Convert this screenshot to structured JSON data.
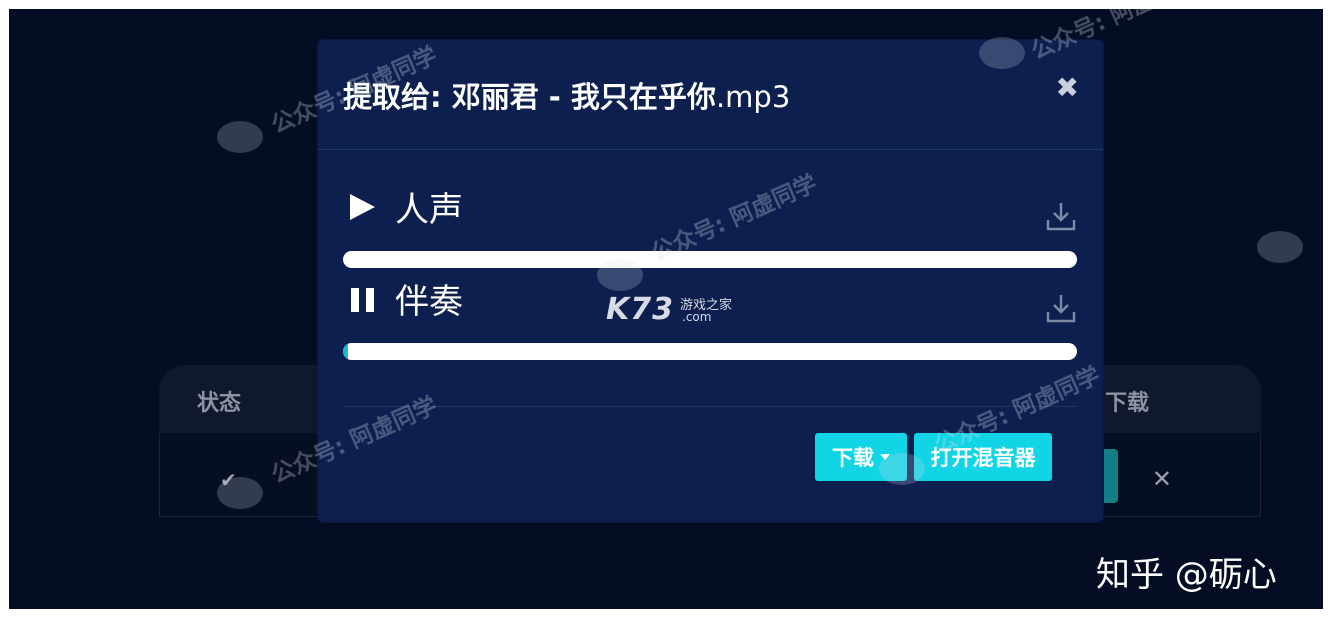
{
  "background_table": {
    "status_header": "状态",
    "download_header": "下载",
    "close_glyph": "✕"
  },
  "modal": {
    "title_main": "提取给: 邓丽君 - 我只在乎你",
    "title_ext": ".mp3",
    "close_glyph": "✖",
    "tracks": [
      {
        "label": "人声",
        "state": "paused",
        "control_icon": "play-icon",
        "progress": 0.0
      },
      {
        "label": "伴奏",
        "state": "playing",
        "control_icon": "pause-icon",
        "progress": 0.007
      }
    ],
    "download_button": "下载",
    "open_mixer_button": "打开混音器"
  },
  "watermarks": {
    "wechat_text": "公众号: 阿虚同学",
    "site_logo": "K73",
    "site_logo_cn": "游戏之家",
    "site_logo_com": ".com",
    "credit": "知乎 @砺心"
  },
  "colors": {
    "page_bg": "#050d24",
    "modal_bg": "#0d1f4f",
    "accent": "#11d4e5",
    "progress_fill": "#19b8d8"
  }
}
